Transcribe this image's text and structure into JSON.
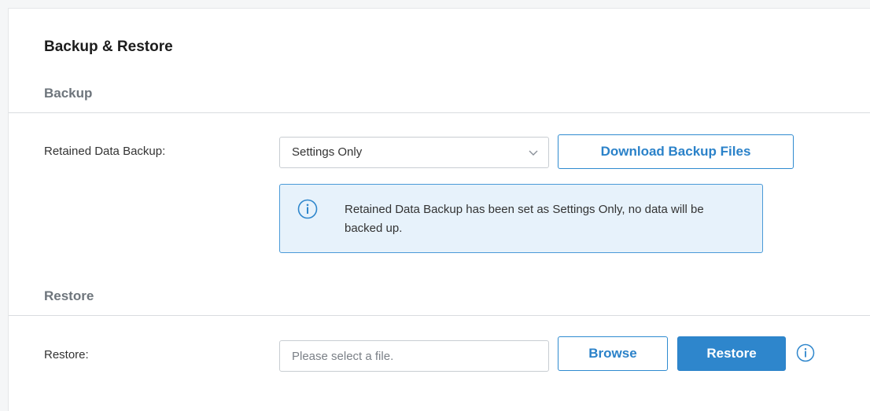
{
  "page": {
    "title": "Backup & Restore"
  },
  "backup": {
    "section_title": "Backup",
    "retained_label": "Retained Data Backup:",
    "retained_select_value": "Settings Only",
    "download_button": "Download Backup Files",
    "info_text": "Retained Data Backup has been set as Settings Only, no data will be backed up.",
    "info_icon": "info-icon"
  },
  "restore": {
    "section_title": "Restore",
    "label": "Restore:",
    "file_placeholder": "Please select a file.",
    "browse_button": "Browse",
    "restore_button": "Restore",
    "help_icon": "info-icon"
  },
  "colors": {
    "accent": "#2e86cc",
    "info_background": "#e7f2fb",
    "section_title": "#6e757c"
  }
}
